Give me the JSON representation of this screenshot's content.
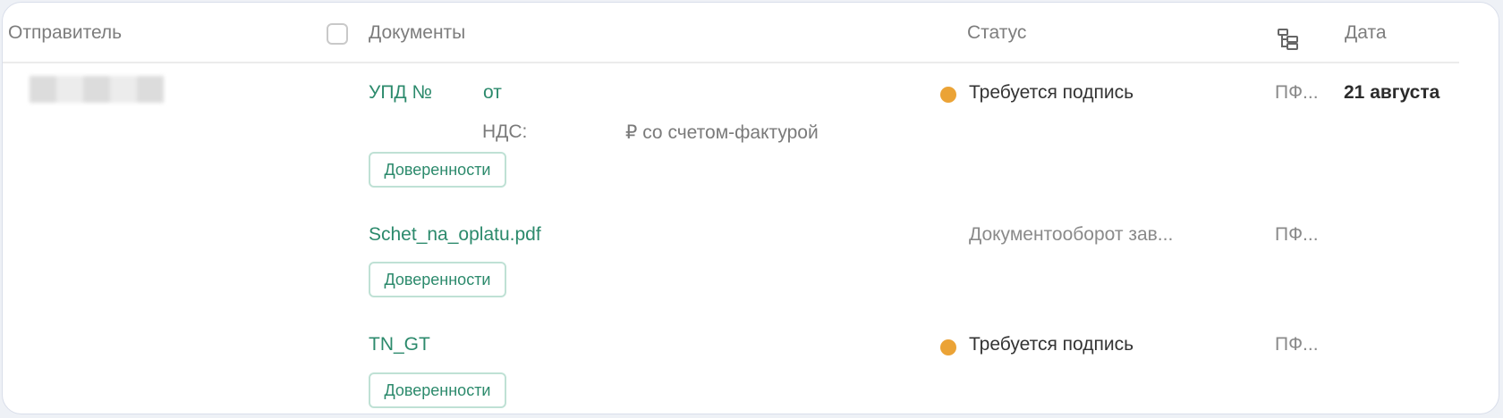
{
  "header": {
    "sender": "Отправитель",
    "documents": "Документы",
    "status": "Статус",
    "date": "Дата"
  },
  "rows": [
    {
      "doc_prefix": "УПД №",
      "doc_from": "от",
      "vat_label": "НДС:",
      "vat_suffix": "₽ со счетом-фактурой",
      "chip": "Доверенности",
      "status": "Требуется подпись",
      "pf": "ПФ...",
      "date": "21 августа"
    },
    {
      "doc_name": "Schet_na_oplatu.pdf",
      "chip": "Доверенности",
      "status": "Документооборот зав...",
      "pf": "ПФ..."
    },
    {
      "doc_name": "TN_GT",
      "chip": "Доверенности",
      "status": "Требуется подпись",
      "pf": "ПФ..."
    }
  ],
  "colors": {
    "link": "#2c8a6c",
    "status_dot": "#eba336",
    "chip_border": "#bfe1d5"
  },
  "icons": {
    "column_settings": "tree-structure-icon"
  }
}
